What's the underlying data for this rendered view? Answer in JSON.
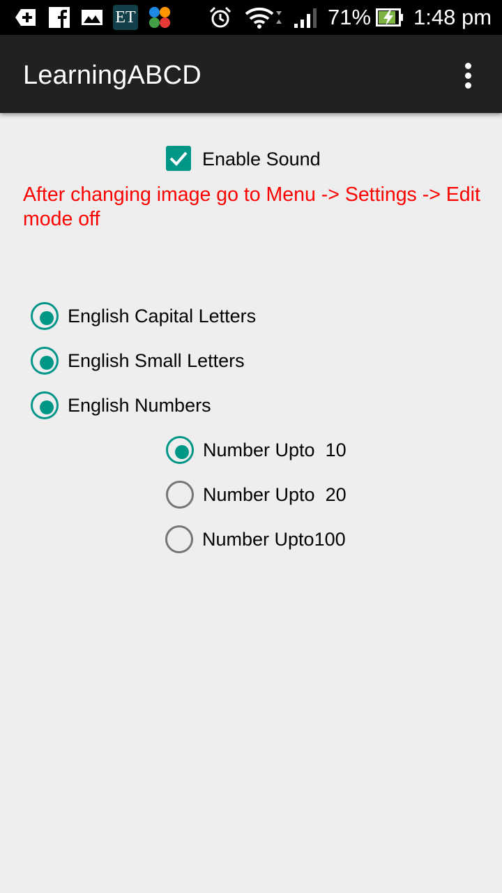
{
  "status_bar": {
    "battery": "71%",
    "time": "1:48 pm",
    "notification_icons": [
      "add-icon",
      "facebook-icon",
      "gallery-icon",
      "et-app-icon",
      "colorful-app-icon"
    ],
    "et_label": "ET",
    "status_icons": [
      "alarm-icon",
      "wifi-icon",
      "signal-icon",
      "battery-charging-icon"
    ]
  },
  "app_bar": {
    "title": "LearningABCD",
    "overflow_icon": "more-vert-icon"
  },
  "settings": {
    "enable_sound": {
      "label": "Enable Sound",
      "checked": true
    },
    "note": "After changing image go to Menu -> Settings -> Edit mode off",
    "options": [
      {
        "label": "English Capital Letters",
        "selected": true
      },
      {
        "label": "English Small Letters",
        "selected": true
      },
      {
        "label": "English Numbers",
        "selected": true
      }
    ],
    "number_options": [
      {
        "label": "Number Upto  10",
        "selected": true
      },
      {
        "label": "Number Upto  20",
        "selected": false
      },
      {
        "label": "Number Upto100",
        "selected": false
      }
    ]
  },
  "colors": {
    "accent": "#009688",
    "note_text": "#ff0000",
    "app_bar": "#212121",
    "status_bar": "#000000",
    "background": "#eeeeee"
  }
}
